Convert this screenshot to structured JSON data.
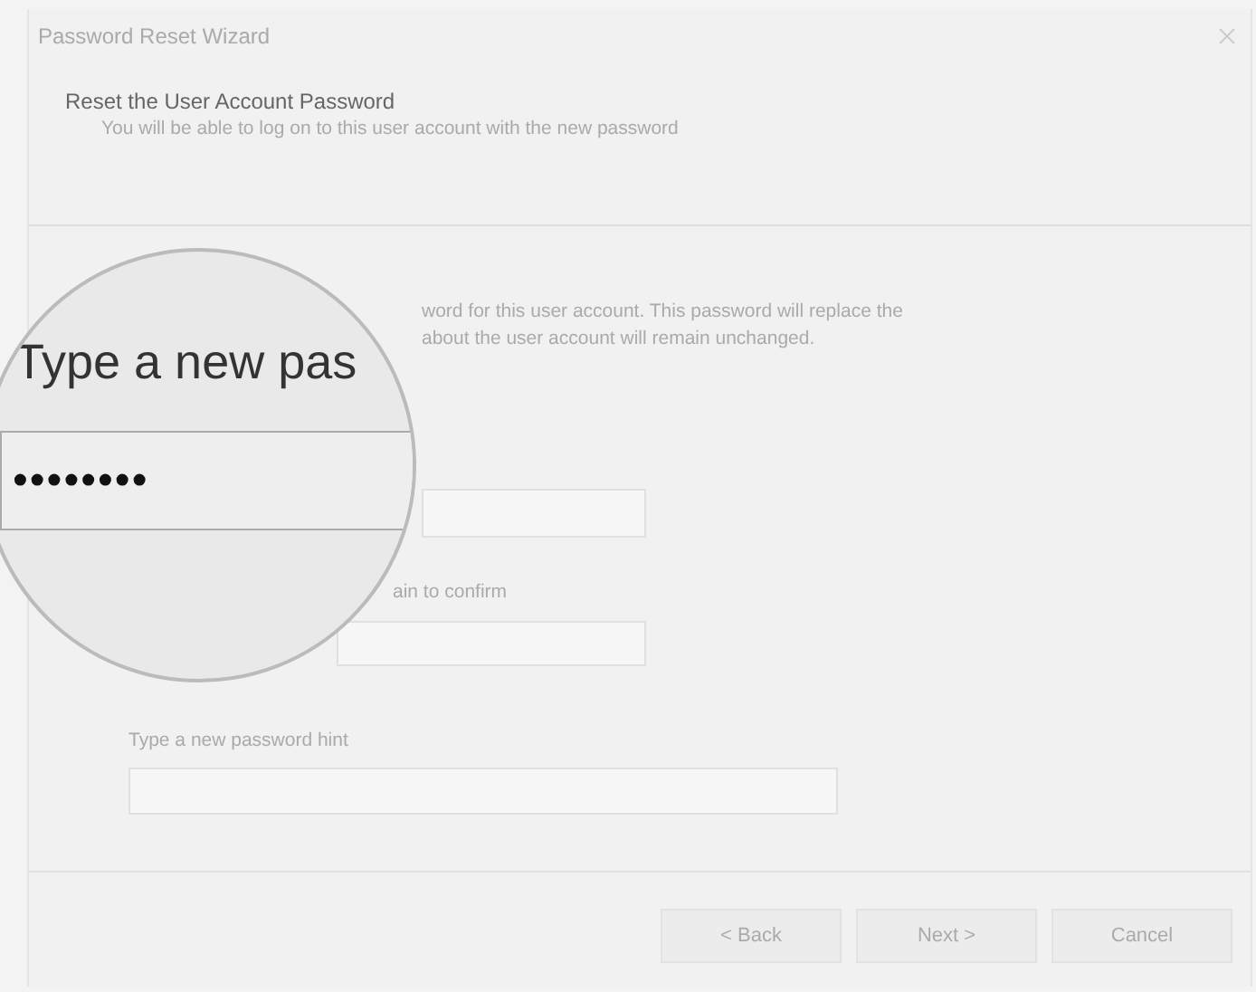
{
  "window": {
    "title": "Password Reset Wizard"
  },
  "header": {
    "heading": "Reset the User Account Password",
    "subtitle": "You will be able to log on to this user account with the new password"
  },
  "instructions": [
    "word for this user account. This password will replace the",
    "about the user account will remain unchanged."
  ],
  "confirm_label": "ain to confirm",
  "hint_label": "Type a new password hint",
  "magnifier": {
    "label": "Type a new pas",
    "value": "••••••••"
  },
  "buttons": [
    "< Back",
    "Next >",
    "Cancel"
  ]
}
